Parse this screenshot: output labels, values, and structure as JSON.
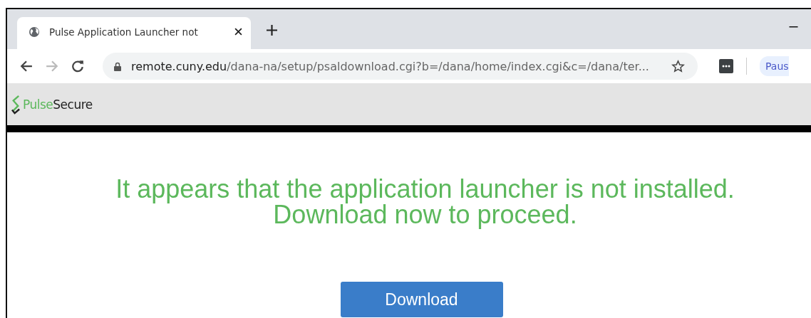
{
  "tab": {
    "title": "Pulse Application Launcher not",
    "selected": true
  },
  "address_bar": {
    "host": "remote.cuny.edu",
    "path": "/dana-na/setup/psaldownload.cgi?b=/dana/home/index.cgi&c=/dana/ter..."
  },
  "profile_button": {
    "label": "Paus"
  },
  "header": {
    "logo_brand": "Pulse",
    "logo_product": "Secure"
  },
  "message": {
    "line_1": "It appears that the application launcher is not installed.",
    "line_2": "Download now to proceed."
  },
  "download_button": {
    "label": "Download"
  }
}
